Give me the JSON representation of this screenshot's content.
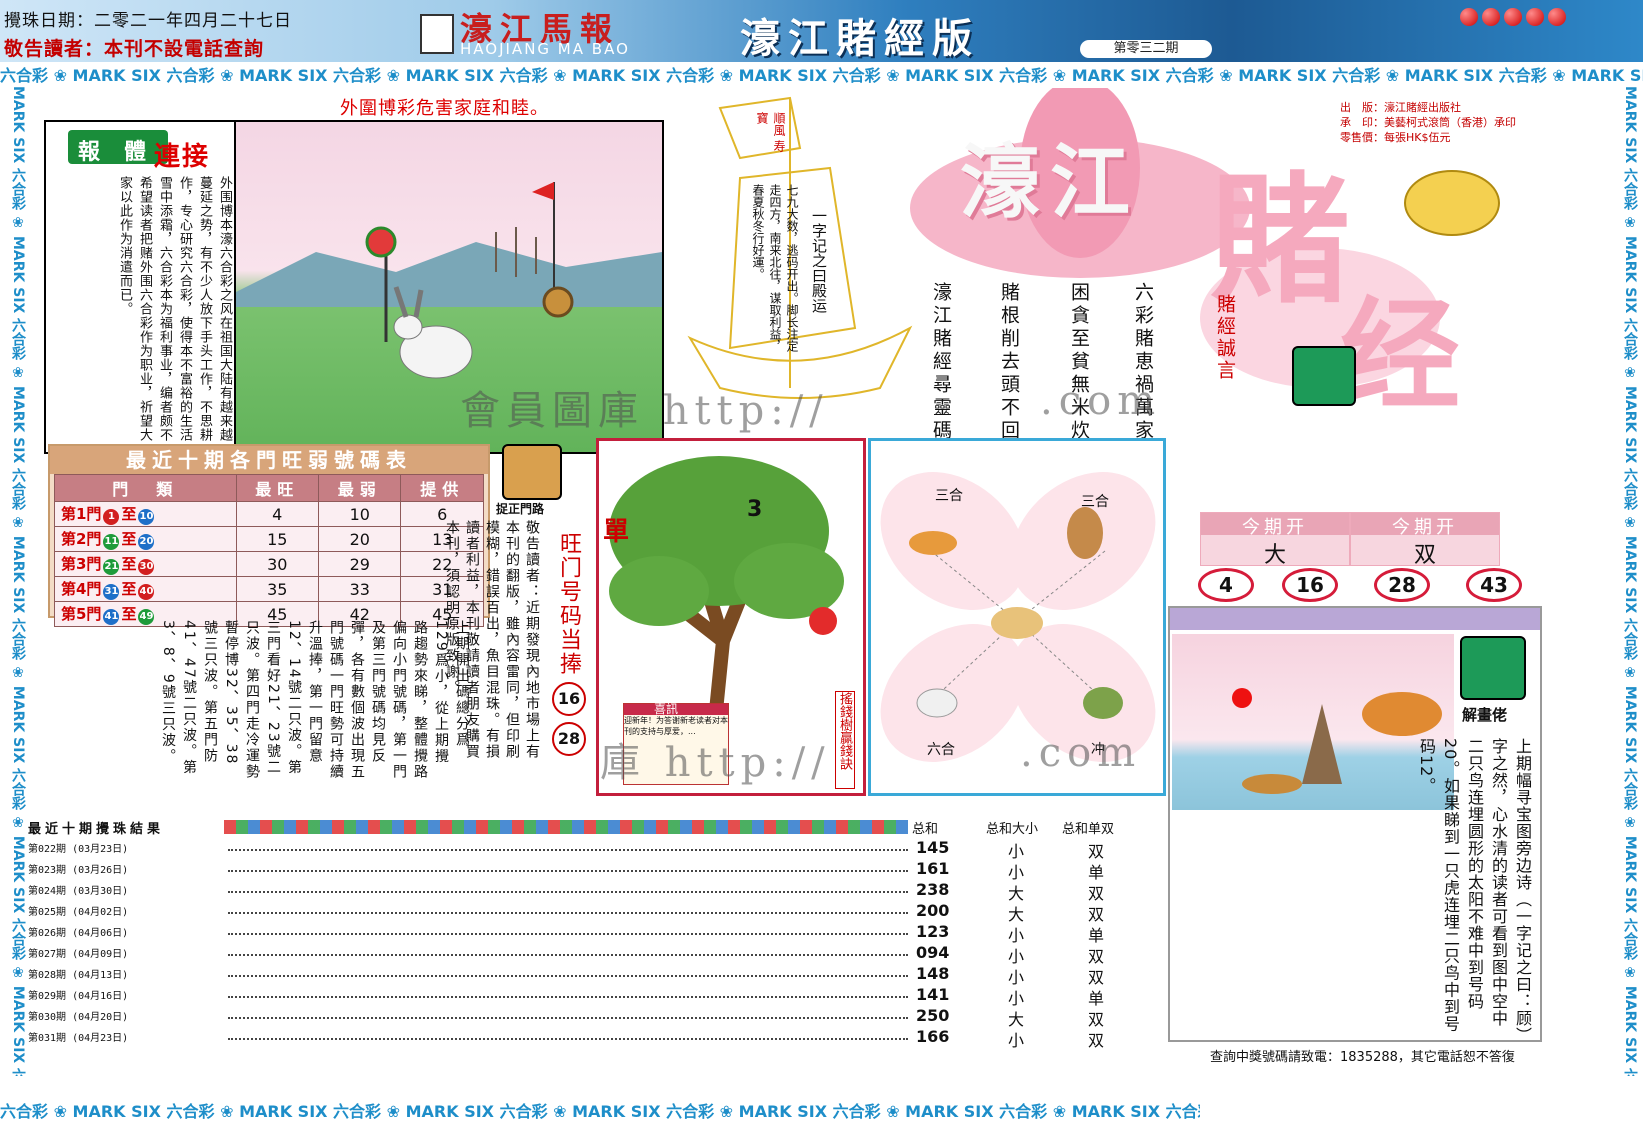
{
  "header": {
    "draw_date": "攪珠日期：二零二一年四月二十七日",
    "notice": "敬告讀者：本刊不設電話查詢",
    "logo_cn": "濠江馬報",
    "logo_en": "HAOJIANG MA BAO",
    "edition": "濠江賭經版",
    "issue": "第零三二期"
  },
  "strip_text": "六合彩 ❀ MARK SIX 六合彩 ❀ MARK SIX 六合彩 ❀ MARK SIX 六合彩 ❀ MARK SIX 六合彩 ❀ MARK SIX 六合彩 ❀ MARK SIX 六合彩 ❀ MARK SIX 六合彩 ❀ MARK SIX 六合彩 ❀ MARK SIX 六合彩 ❀ MARK SIX",
  "vstrip_text": "MARK SIX 六合彩 ❀ MARK SIX 六合彩 ❀ MARK SIX 六合彩 ❀ MARK SIX 六合彩 ❀ MARK SIX 六合彩 ❀ MARK SIX 六合彩 ❀ MARK SIX 六合彩",
  "warning": "外圍博彩危害家庭和睦。",
  "connect": {
    "badge1": "報",
    "badge2": "體",
    "title": "連接",
    "text": "外围博本濠六合彩之风在祖国大陆有越来越蔓延之势，有不少人放下手头工作，不思耕作，专心研究六合彩，使得本不富裕的生活雪中添霜，六合彩本为福利事业，编者颇不希望读者把赌外围六合彩作为职业，祈望大家以此作为消遣而已。"
  },
  "sail": {
    "flag": "順風 寿寶",
    "left_text": "七九大数，逃码开出。脚长注定走四方，南来北往，谋取利益，春夏秋冬行好運。",
    "right_text": "一字记之曰殿运"
  },
  "title": {
    "t1": "濠江",
    "t2": "賭",
    "t3": "经",
    "motto": "賭經誠言"
  },
  "publisher": {
    "line1": "出　版：濠江賭經出版社",
    "line2": "承　印：美藝柯式滾筒（香港）承印",
    "line3": "零售價：每張HK$伍元"
  },
  "poem": [
    "六彩賭恵禍萬家",
    "困貪至貧無米炊",
    "賭根削去頭不回",
    "濠江賭經尋靈碼"
  ],
  "table": {
    "title": "最近十期各門旺弱號碼表",
    "headers": [
      "門　類",
      "最旺",
      "最弱",
      "提供"
    ],
    "rows": [
      {
        "label": "第1門",
        "a": "1",
        "b": "10",
        "ac": "#d21f1f",
        "bc": "#1e6fc8",
        "max": "4",
        "min": "10",
        "offer": "6"
      },
      {
        "label": "第2門",
        "a": "11",
        "b": "20",
        "ac": "#1e9b3a",
        "bc": "#1e6fc8",
        "max": "15",
        "min": "20",
        "offer": "13"
      },
      {
        "label": "第3門",
        "a": "21",
        "b": "30",
        "ac": "#1e9b3a",
        "bc": "#d21f1f",
        "max": "30",
        "min": "29",
        "offer": "22"
      },
      {
        "label": "第4門",
        "a": "31",
        "b": "40",
        "ac": "#1e6fc8",
        "bc": "#d21f1f",
        "max": "35",
        "min": "33",
        "offer": "31"
      },
      {
        "label": "第5門",
        "a": "41",
        "b": "49",
        "ac": "#1e6fc8",
        "bc": "#1e9b3a",
        "max": "45",
        "min": "42",
        "offer": "45"
      }
    ]
  },
  "icon_label": "捉正門路",
  "notice_text": "敬告讀者：近期發現內地市場上有本刊的翻版，雖內容雷同，但印刷模糊，錯誤百出，魚目混珠。有損讀者利益，本刊敬請讀者朋友購買本刊，須認明原版致謝。",
  "analysis": "上期開出碼總分爲129爲小，從上期攪路趨勢來睇，整體攪路偏向小門號碼，第一門及第三門號碼均見反彈，各有數個波出現五門號碼一門旺勢可持續升溫捧，第一門留意12、14號二只波。第三門看好21、23號二只波。第四門走冷運勢暫停博32、35、38號三只波。第五門防41、47號二只波。第3、8、9號三只波。",
  "wangmen": {
    "title": "旺门号码当捧",
    "n1": "16",
    "n2": "28"
  },
  "tree": {
    "label_left": "單",
    "label_num": "3",
    "side": "搖錢樹贏錢訣",
    "card_title": "喜訊",
    "card_text": "迎新年！为答谢新老读者对本刊的支持与厚爱，..."
  },
  "zodiac": {
    "tl": "三合",
    "tr": "三合",
    "bl": "六合",
    "br": "冲"
  },
  "kai": {
    "head1": "今期开",
    "val1": "大",
    "head2": "今期开",
    "val2": "双",
    "nums": [
      "4",
      "16",
      "28",
      "43"
    ]
  },
  "panel": {
    "label": "解畫佬",
    "text": "上期幅寻宝图旁边诗（一字记之曰：顾）字之然，心水清的读者可看到图中空中二只鸟连埋圆形的太阳不难中到号码20。如果睇到一只虎连埋二只鸟中到号码12。"
  },
  "results": {
    "title": "最近十期攪珠結果",
    "col_sum": "总和",
    "col_size": "总和大小",
    "col_oe": "总和单双",
    "rows": [
      {
        "label": "第022期 (03月23日)",
        "sum": "145",
        "size": "小",
        "oe": "双"
      },
      {
        "label": "第023期 (03月26日)",
        "sum": "161",
        "size": "小",
        "oe": "单"
      },
      {
        "label": "第024期 (03月30日)",
        "sum": "238",
        "size": "大",
        "oe": "双"
      },
      {
        "label": "第025期 (04月02日)",
        "sum": "200",
        "size": "大",
        "oe": "双"
      },
      {
        "label": "第026期 (04月06日)",
        "sum": "123",
        "size": "小",
        "oe": "单"
      },
      {
        "label": "第027期 (04月09日)",
        "sum": "094",
        "size": "小",
        "oe": "双"
      },
      {
        "label": "第028期 (04月13日)",
        "sum": "148",
        "size": "小",
        "oe": "双"
      },
      {
        "label": "第029期 (04月16日)",
        "sum": "141",
        "size": "小",
        "oe": "单"
      },
      {
        "label": "第030期 (04月20日)",
        "sum": "250",
        "size": "大",
        "oe": "双"
      },
      {
        "label": "第031期 (04月23日)",
        "sum": "166",
        "size": "小",
        "oe": "双"
      }
    ]
  },
  "footer": "查詢中獎號碼請致電：1835288，其它電話恕不答復",
  "watermark1": "會員圖庫 http://",
  "watermark2": ".com",
  "watermark3": "庫 http://",
  "watermark4": ".com"
}
